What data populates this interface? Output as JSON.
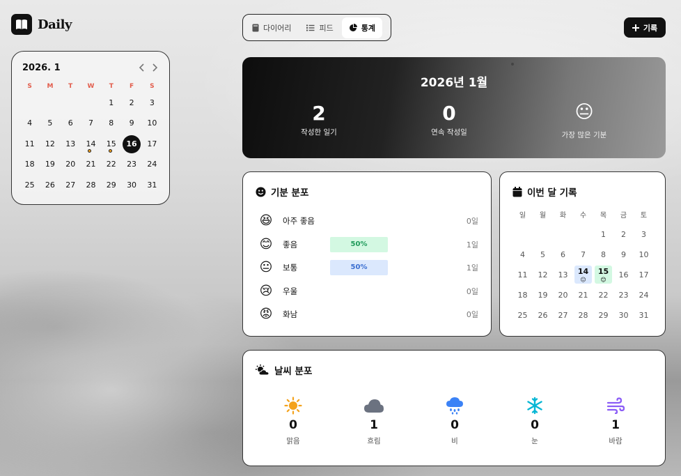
{
  "app": {
    "name": "Daily"
  },
  "tabs": [
    {
      "label": "다이어리",
      "icon": "book-icon",
      "active": false
    },
    {
      "label": "피드",
      "icon": "list-icon",
      "active": false
    },
    {
      "label": "통계",
      "icon": "pie-chart-icon",
      "active": true
    }
  ],
  "record_button": {
    "label": "기록",
    "icon": "plus-icon"
  },
  "mini_calendar": {
    "title": "2026. 1",
    "weekdays": [
      "S",
      "M",
      "T",
      "W",
      "T",
      "F",
      "S"
    ],
    "today": "16",
    "entries": [
      "14",
      "15"
    ]
  },
  "stats": {
    "title": "2026년 1월",
    "written_count": "2",
    "written_label": "작성한 일기",
    "streak_count": "0",
    "streak_label": "연속 작성일",
    "top_mood_emoji": "😐",
    "top_mood_label": "가장 많은 기분"
  },
  "mood_distribution": {
    "title": "기분 분포",
    "icon": "smiley-icon",
    "items": [
      {
        "emoji": "😆",
        "label": "아주 좋음",
        "percent": "",
        "count": "0일",
        "fill": 0
      },
      {
        "emoji": "😊",
        "label": "좋음",
        "percent": "50%",
        "count": "1일",
        "fill": 0.5
      },
      {
        "emoji": "😐",
        "label": "보통",
        "percent": "50%",
        "count": "1일",
        "fill": 0.5
      },
      {
        "emoji": "😢",
        "label": "우울",
        "percent": "",
        "count": "0일",
        "fill": 0
      },
      {
        "emoji": "😡",
        "label": "화남",
        "percent": "",
        "count": "0일",
        "fill": 0
      }
    ],
    "colors": {
      "good": "#d3f8e2",
      "good_text": "#1f9a5a",
      "normal": "#dbe8fd",
      "normal_text": "#3b6fd1"
    }
  },
  "month_record": {
    "title": "이번 달 기록",
    "icon": "calendar-icon",
    "weekdays": [
      "일",
      "월",
      "화",
      "수",
      "목",
      "금",
      "토"
    ],
    "records": [
      {
        "day": "14",
        "emoji": "😐"
      },
      {
        "day": "15",
        "emoji": "😊"
      }
    ]
  },
  "weather_distribution": {
    "title": "날씨 분포",
    "icon": "weather-icon",
    "items": [
      {
        "icon": "sun-icon",
        "value": "0",
        "label": "맑음",
        "color": "#f4a21b"
      },
      {
        "icon": "cloud-icon",
        "value": "1",
        "label": "흐림",
        "color": "#6b7280"
      },
      {
        "icon": "rain-icon",
        "value": "0",
        "label": "비",
        "color": "#3b82f6"
      },
      {
        "icon": "snow-icon",
        "value": "0",
        "label": "눈",
        "color": "#06b6d4"
      },
      {
        "icon": "wind-icon",
        "value": "1",
        "label": "바람",
        "color": "#8b5cf6"
      }
    ]
  }
}
